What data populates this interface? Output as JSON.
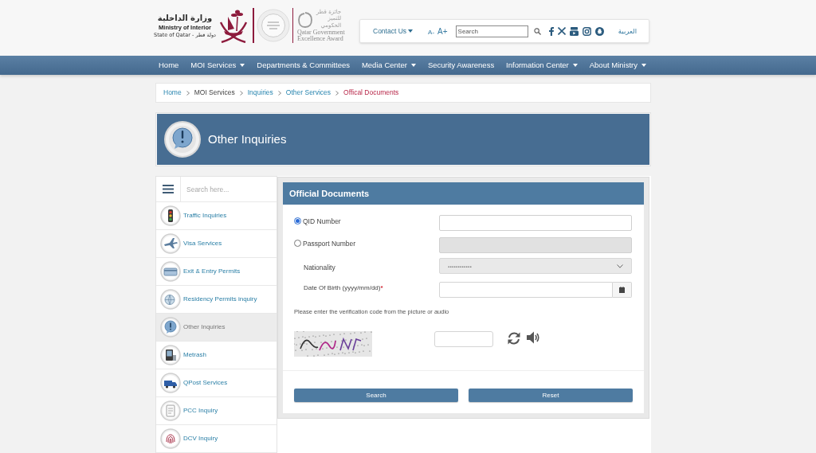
{
  "header": {
    "logo": {
      "arabic_name": "وزارة الداخلية",
      "name": "Ministry of Interior",
      "subtitle": "State of Qatar - دولة قطر"
    },
    "award": {
      "arabic_lines": [
        "جائزة قطر",
        "للتميز",
        "الحكومي"
      ],
      "name": "Qatar Government Excellence Award"
    },
    "contact_menu": "Contact Us",
    "text_size": [
      {
        "label": "A-",
        "kind": "decrease"
      },
      {
        "label": "A+",
        "kind": "increase"
      }
    ],
    "search": {
      "placeholder": "Search"
    },
    "language_link": "العربية"
  },
  "nav": [
    {
      "label": "Home",
      "has_menu": false
    },
    {
      "label": "MOI Services",
      "has_menu": true
    },
    {
      "label": "Departments & Committees",
      "has_menu": false
    },
    {
      "label": "Media Center",
      "has_menu": true
    },
    {
      "label": "Security Awareness",
      "has_menu": false
    },
    {
      "label": "Information Center",
      "has_menu": true
    },
    {
      "label": "About Ministry",
      "has_menu": true
    }
  ],
  "breadcrumb": [
    {
      "label": "Home",
      "kind": "link"
    },
    {
      "label": "MOI Services",
      "kind": "plain"
    },
    {
      "label": "Inquiries",
      "kind": "link"
    },
    {
      "label": "Other Services",
      "kind": "link"
    },
    {
      "label": "Offical Documents",
      "kind": "current"
    }
  ],
  "banner": {
    "title": "Other Inquiries"
  },
  "sidebar": {
    "search": {
      "placeholder": "Search here..."
    },
    "items": [
      {
        "label": "Traffic Inquiries",
        "kind": "traffic",
        "selected": false
      },
      {
        "label": "Visa Services",
        "kind": "visa",
        "selected": false
      },
      {
        "label": "Exit & Entry Permits",
        "kind": "permit",
        "selected": false
      },
      {
        "label": "Residency Permits inquiry",
        "kind": "residency",
        "selected": false
      },
      {
        "label": "Other Inquiries",
        "kind": "inquiry",
        "selected": true
      },
      {
        "label": "Metrash",
        "kind": "metrash",
        "selected": false
      },
      {
        "label": "QPost Services",
        "kind": "post",
        "selected": false
      },
      {
        "label": "PCC Inquiry",
        "kind": "pcc",
        "selected": false
      },
      {
        "label": "DCV Inquiry",
        "kind": "dcv",
        "selected": false
      }
    ]
  },
  "form": {
    "title": "Official Documents",
    "id_options": [
      {
        "label": "QID Number",
        "selected": true,
        "field_disabled": false
      },
      {
        "label": "Passport Number",
        "selected": false,
        "field_disabled": true
      }
    ],
    "nationality": {
      "label": "Nationality",
      "placeholder": "............",
      "disabled": true
    },
    "birth_date": {
      "label": "Date Of Birth (yyyy/mm/dd)",
      "required_mark": "*"
    },
    "captcha_hint": "Please enter the verification code from the picture or audio",
    "buttons": [
      "Search",
      "Reset"
    ]
  }
}
